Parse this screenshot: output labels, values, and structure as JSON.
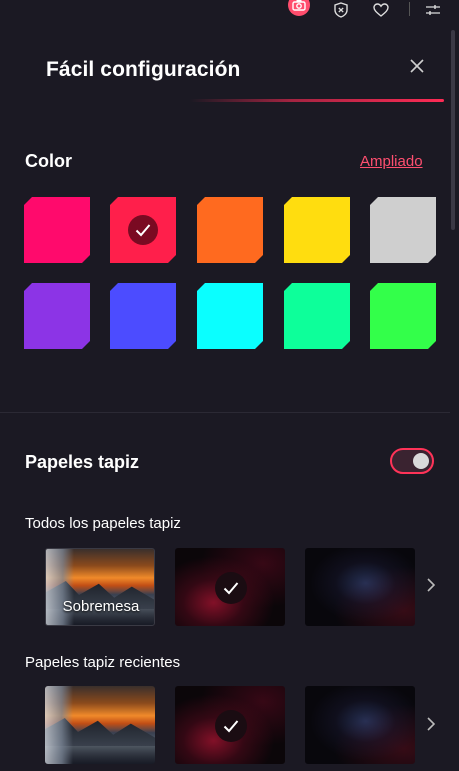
{
  "toolbar": {
    "icons": [
      "camera-icon",
      "shield-icon",
      "heart-icon",
      "settings-sliders-icon"
    ],
    "accent": "#ff4d6d"
  },
  "panel": {
    "title": "Fácil configuración",
    "close_icon": "close-icon"
  },
  "color_section": {
    "label": "Color",
    "expand_link": "Ampliado",
    "selected_index": 1,
    "swatches": [
      "#ff0a6c",
      "#ff1f4b",
      "#ff6a1f",
      "#ffdd0f",
      "#cfcfcf",
      "#8c34e6",
      "#4c4cff",
      "#0affff",
      "#0dff9a",
      "#33ff4a"
    ]
  },
  "wallpapers": {
    "label": "Papeles tapiz",
    "toggle_on": true,
    "all": {
      "label": "Todos los papeles tapiz",
      "items": [
        {
          "caption": "Sobremesa",
          "style": "landscape",
          "selected": false
        },
        {
          "caption": "",
          "style": "red",
          "selected": true
        },
        {
          "caption": "",
          "style": "blue",
          "selected": false
        }
      ]
    },
    "recent": {
      "label": "Papeles tapiz recientes",
      "items": [
        {
          "caption": "",
          "style": "landscape",
          "selected": false
        },
        {
          "caption": "",
          "style": "red",
          "selected": true
        },
        {
          "caption": "",
          "style": "blue",
          "selected": false
        }
      ]
    }
  }
}
